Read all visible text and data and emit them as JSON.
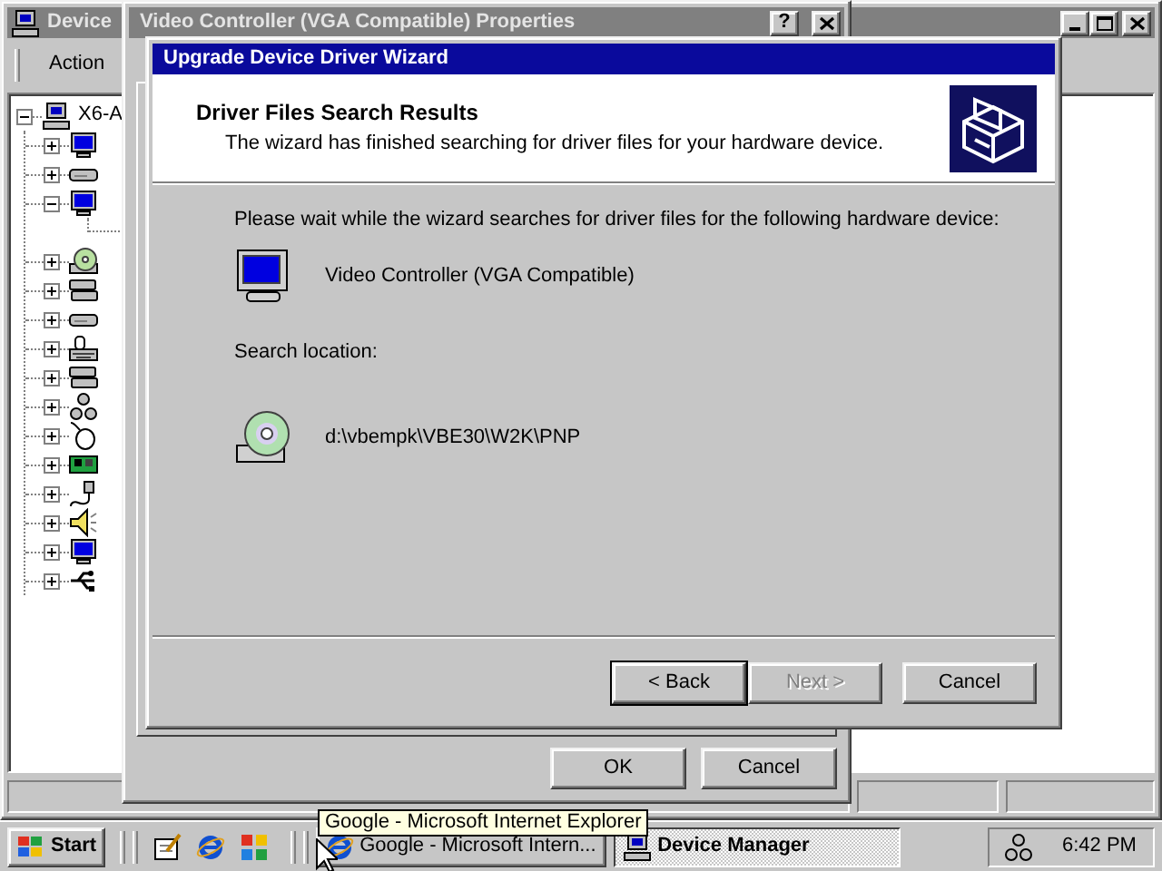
{
  "device_manager": {
    "title": "Device",
    "menu": [
      {
        "label": "Action"
      }
    ],
    "tree": {
      "label": "X6-A",
      "kind": "computer",
      "expanded": true,
      "children": [
        {
          "kind": "monitor",
          "expanded": false
        },
        {
          "kind": "drive",
          "expanded": false
        },
        {
          "kind": "monitor",
          "expanded": true
        },
        {
          "kind": "disc",
          "expanded": false
        },
        {
          "kind": "drives",
          "expanded": false
        },
        {
          "kind": "drive",
          "expanded": false
        },
        {
          "kind": "keyboard",
          "expanded": false
        },
        {
          "kind": "drives",
          "expanded": false
        },
        {
          "kind": "network",
          "expanded": false
        },
        {
          "kind": "mouse",
          "expanded": false
        },
        {
          "kind": "card",
          "expanded": false
        },
        {
          "kind": "plug",
          "expanded": false
        },
        {
          "kind": "speaker",
          "expanded": false
        },
        {
          "kind": "monitor",
          "expanded": false
        },
        {
          "kind": "usb",
          "expanded": false
        }
      ]
    }
  },
  "properties": {
    "title": "Video Controller (VGA Compatible) Properties",
    "help": "?",
    "buttons": [
      {
        "label": "OK"
      },
      {
        "label": "Cancel"
      }
    ]
  },
  "wizard": {
    "title": "Upgrade Device Driver Wizard",
    "header": {
      "title": "Driver Files Search Results",
      "subtitle": "The wizard has finished searching for driver files for your hardware device."
    },
    "intro": "Please wait while the wizard searches for driver files for the following hardware device:",
    "device": "Video Controller (VGA Compatible)",
    "location_label": "Search location:",
    "location": "d:\\vbempk\\VBE30\\W2K\\PNP",
    "buttons": [
      {
        "label": "< Back",
        "default": true,
        "disabled": false
      },
      {
        "label": "Next >",
        "default": false,
        "disabled": true
      },
      {
        "label": "Cancel",
        "default": false,
        "disabled": false
      }
    ]
  },
  "taskbar": {
    "start": "Start",
    "quick_launch": [
      {
        "kind": "desktop"
      },
      {
        "kind": "browser"
      },
      {
        "kind": "channels"
      }
    ],
    "tasks": [
      {
        "label": "Google - Microsoft Intern...",
        "kind": "browser",
        "selected": false
      },
      {
        "label": "Device Manager",
        "kind": "computer",
        "selected": true
      }
    ],
    "tooltip": "Google - Microsoft Internet Explorer",
    "clock": "6:42 PM"
  }
}
